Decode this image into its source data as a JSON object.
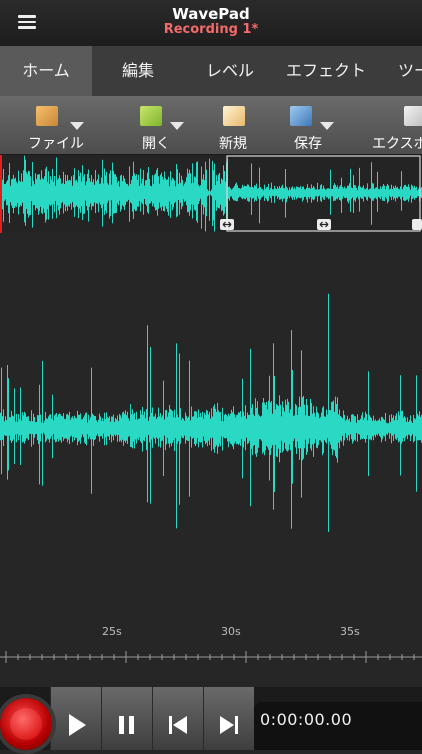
{
  "header": {
    "app_title": "WavePad",
    "file_title": "Recording 1*",
    "menu_icon": "hamburger-menu-icon"
  },
  "tabs": [
    {
      "label": "ホーム",
      "active": true
    },
    {
      "label": "編集",
      "active": false
    },
    {
      "label": "レベル",
      "active": false
    },
    {
      "label": "エフェクト",
      "active": false
    },
    {
      "label": "ツー",
      "active": false
    }
  ],
  "toolbar": [
    {
      "label": "ファイル",
      "icon": "file-icon",
      "dropdown": true
    },
    {
      "label": "開く",
      "icon": "open-folder-icon",
      "dropdown": true
    },
    {
      "label": "新規",
      "icon": "new-file-icon",
      "dropdown": false
    },
    {
      "label": "保存",
      "icon": "save-icon",
      "dropdown": true
    },
    {
      "label": "エクスポ",
      "icon": "export-icon",
      "dropdown": false
    }
  ],
  "timeline": {
    "ticks": [
      "25s",
      "30s",
      "35s"
    ]
  },
  "transport": {
    "time": "0:00:00.00",
    "buttons": [
      "record-icon",
      "play-icon",
      "pause-icon",
      "skip-back-icon",
      "skip-forward-icon"
    ]
  },
  "colors": {
    "waveform": "#2ad9c4",
    "playhead": "#e01f1f",
    "accent_title": "#f26a6a"
  }
}
